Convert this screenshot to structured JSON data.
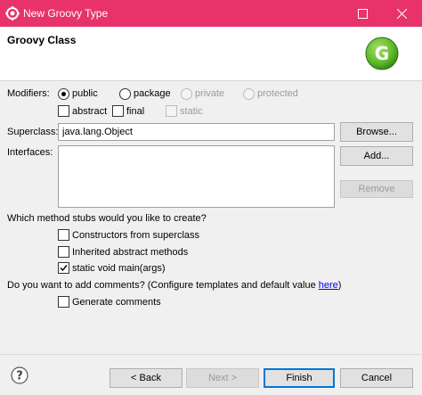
{
  "window": {
    "title": "New Groovy Type"
  },
  "header": {
    "title": "Groovy Class",
    "logo_letter": "G"
  },
  "modifiers": {
    "label": "Modifiers:",
    "radios": [
      {
        "label": "public",
        "checked": true,
        "enabled": true
      },
      {
        "label": "package",
        "checked": false,
        "enabled": true
      },
      {
        "label": "private",
        "checked": false,
        "enabled": false
      },
      {
        "label": "protected",
        "checked": false,
        "enabled": false
      }
    ],
    "checks": [
      {
        "label": "abstract",
        "checked": false,
        "enabled": true
      },
      {
        "label": "final",
        "checked": false,
        "enabled": true
      },
      {
        "label": "static",
        "checked": false,
        "enabled": false
      }
    ]
  },
  "superclass": {
    "label": "Superclass:",
    "value": "java.lang.Object",
    "browse_label": "Browse..."
  },
  "interfaces": {
    "label": "Interfaces:",
    "add_label": "Add...",
    "remove_label": "Remove"
  },
  "stubs": {
    "question": "Which method stubs would you like to create?",
    "options": [
      {
        "label": "Constructors from superclass",
        "checked": false
      },
      {
        "label": "Inherited abstract methods",
        "checked": false
      },
      {
        "label": "static void main(args)",
        "checked": true
      }
    ]
  },
  "comments": {
    "question_prefix": "Do you want to add comments? (Configure templates and default value ",
    "link": "here",
    "question_suffix": ")",
    "option": "Generate comments"
  },
  "footer": {
    "back": "< Back",
    "next": "Next >",
    "finish": "Finish",
    "cancel": "Cancel"
  },
  "colors": {
    "titlebar": "#e8336a",
    "logo_green": "#5cb82b"
  }
}
